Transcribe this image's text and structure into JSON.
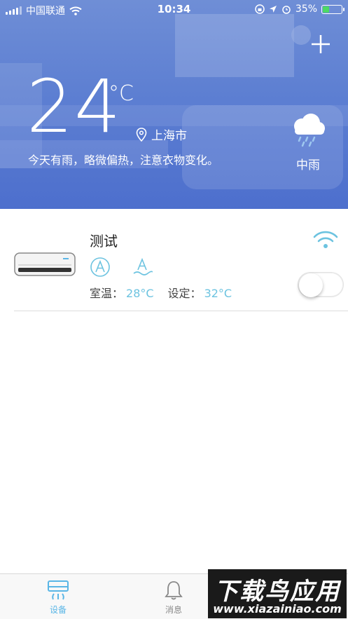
{
  "status_bar": {
    "carrier": "中国联通",
    "time": "10:34",
    "battery_percent": "35%",
    "battery_level": 0.35
  },
  "header": {
    "add_icon": "plus-icon",
    "temperature": "24",
    "temperature_unit": "°C",
    "location": "上海市",
    "description": "今天有雨，略微偏热，注意衣物变化。",
    "weather_icon": "cloud-rain-icon",
    "weather_label": "中雨"
  },
  "devices": [
    {
      "name": "测试",
      "indoor_label": "室温：",
      "indoor_value": "28°C",
      "setpoint_label": "设定：",
      "setpoint_value": "32°C",
      "mode_icons": [
        "auto-mode-icon",
        "auto-wind-icon"
      ],
      "online_icon": "wifi-icon",
      "power_on": false
    }
  ],
  "tabbar": {
    "tabs": [
      {
        "label": "设备",
        "icon": "device-icon",
        "active": true
      },
      {
        "label": "消息",
        "icon": "bell-icon",
        "active": false
      }
    ]
  },
  "watermark": {
    "title": "下载鸟应用",
    "url": "www.xiazainiao.com"
  },
  "colors": {
    "hero": "#5d7fd2",
    "accent": "#5ab6e6",
    "value": "#6cc3e0"
  }
}
